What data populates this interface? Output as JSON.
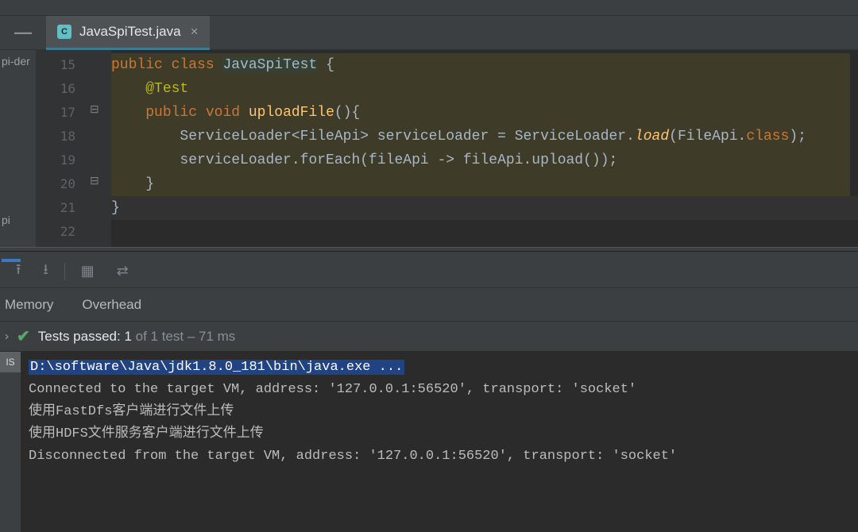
{
  "side": {
    "stub1": "pi-der",
    "stub2": "pi"
  },
  "tab": {
    "filename": "JavaSpiTest.java"
  },
  "gutter": {
    "lines": [
      "15",
      "16",
      "17",
      "18",
      "19",
      "20",
      "21",
      "22"
    ]
  },
  "code": {
    "l15": {
      "kw1": "public",
      "kw2": "class",
      "name": "JavaSpiTest",
      "br": " {"
    },
    "l16": {
      "ann": "@Test"
    },
    "l17": {
      "kw1": "public",
      "kw2": "void",
      "mth": "uploadFile",
      "rest": "(){"
    },
    "l18": {
      "a": "ServiceLoader<FileApi> serviceLoader = ServiceLoader.",
      "load": "load",
      "b": "(FileApi.",
      "cls": "class",
      "c": ");"
    },
    "l19": {
      "a": "serviceLoader.forEach(fileApi -> fileApi.upload());"
    },
    "l20": {
      "a": "}"
    },
    "l21": {
      "a": "}"
    }
  },
  "subtabs": {
    "memory": "Memory",
    "overhead": "Overhead"
  },
  "status": {
    "prefix": "Tests passed: ",
    "count": "1",
    "suffix": " of 1 test – 71 ms"
  },
  "console": {
    "nav_label": "IS",
    "cmd": "D:\\software\\Java\\jdk1.8.0_181\\bin\\java.exe ...",
    "line2": "Connected to the target VM, address: '127.0.0.1:56520', transport: 'socket'",
    "line3": "使用FastDfs客户端进行文件上传",
    "line4": "使用HDFS文件服务客户端进行文件上传",
    "line5": "Disconnected from the target VM, address: '127.0.0.1:56520', transport: 'socket'"
  }
}
